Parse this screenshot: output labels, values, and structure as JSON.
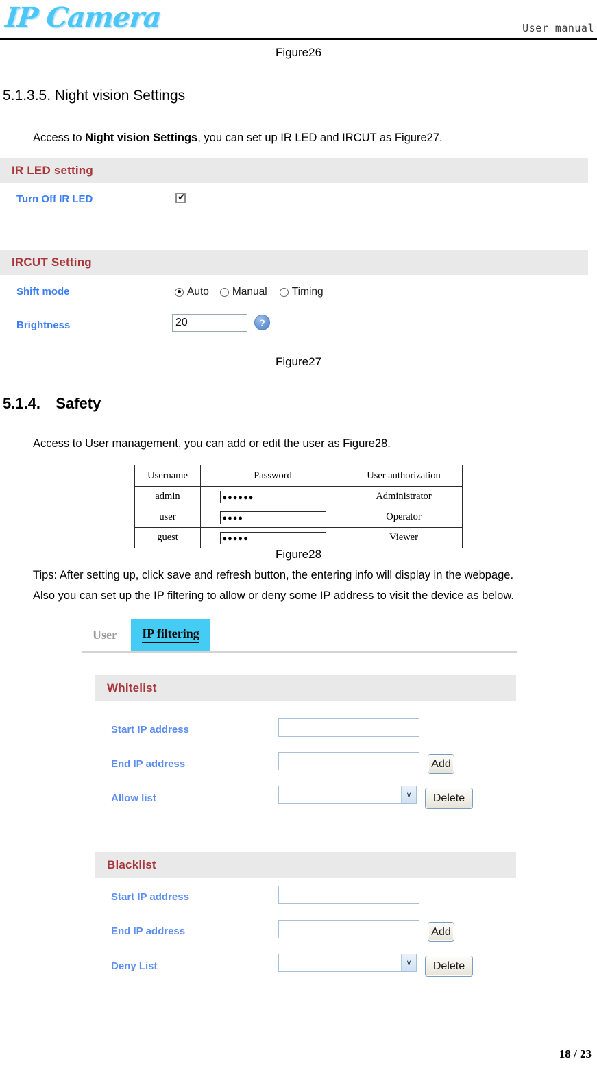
{
  "header": {
    "logo_text": "IP Camera",
    "right_label": "User manual"
  },
  "captions": {
    "figure26": "Figure26",
    "figure27": "Figure27",
    "figure28": "Figure28"
  },
  "sections": {
    "night_vision": {
      "number": "5.1.3.5.",
      "title": "Night vision Settings",
      "intro_before": "Access to ",
      "intro_bold": "Night vision Settings",
      "intro_after": ", you can set up IR LED and IRCUT as Figure27."
    },
    "safety": {
      "number": "5.1.4.",
      "title": "Safety",
      "intro": "Access to User management, you can add or edit the user as Figure28.",
      "tips_line1": "Tips: After setting up, click save and refresh button, the entering info will display in the webpage.",
      "tips_line2": "Also you can set up the IP filtering to allow or deny some IP address to visit the device as below."
    }
  },
  "ir_led_panel": {
    "title": "IR LED setting",
    "turn_off_label": "Turn Off IR LED",
    "turn_off_checked": true,
    "check_glyph": "✔"
  },
  "ircut_panel": {
    "title": "IRCUT Setting",
    "shift_mode_label": "Shift mode",
    "shift_mode_options": [
      "Auto",
      "Manual",
      "Timing"
    ],
    "shift_mode_selected": "Auto",
    "brightness_label": "Brightness",
    "brightness_value": "20",
    "help_glyph": "?"
  },
  "user_table": {
    "columns": [
      "Username",
      "Password",
      "User authorization"
    ],
    "rows": [
      {
        "username": "admin",
        "password_mask": "●●●●●●",
        "authorization": "Administrator",
        "highlighted": false
      },
      {
        "username": "user",
        "password_mask": "●●●●",
        "authorization": "Operator",
        "highlighted": true
      },
      {
        "username": "guest",
        "password_mask": "●●●●●",
        "authorization": "Viewer",
        "highlighted": false
      }
    ]
  },
  "ip_filtering": {
    "tabs": [
      {
        "label": "User",
        "active": false
      },
      {
        "label": "IP filtering",
        "active": true
      }
    ],
    "whitelist": {
      "title": "Whitelist",
      "start_ip_label": "Start IP address",
      "start_ip_value": "",
      "end_ip_label": "End IP address",
      "end_ip_value": "",
      "list_label": "Allow list",
      "list_value": "",
      "add_button": "Add",
      "delete_button": "Delete",
      "chevron_glyph": "∨"
    },
    "blacklist": {
      "title": "Blacklist",
      "start_ip_label": "Start IP address",
      "start_ip_value": "",
      "end_ip_label": "End IP address",
      "end_ip_value": "",
      "list_label": "Deny List",
      "list_value": "",
      "add_button": "Add",
      "delete_button": "Delete",
      "chevron_glyph": "∨"
    }
  },
  "footer": {
    "page_number": "18 / 23"
  },
  "colors": {
    "logo_cyan": "#4cc6f7",
    "panel_title_red": "#a8363a",
    "label_blue": "#3b7ef5",
    "tab_active_cyan": "#45ccf5",
    "panel_bg_gray": "#e9e9e9"
  }
}
